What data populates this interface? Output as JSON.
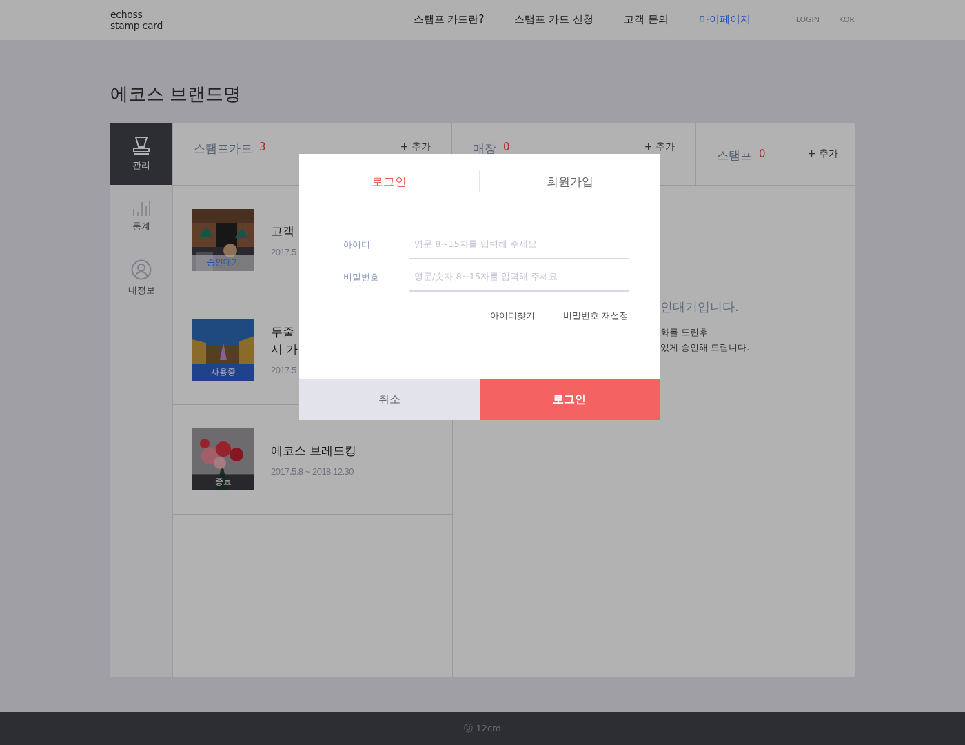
{
  "header": {
    "logo": [
      "echoss",
      "stamp card"
    ],
    "nav": [
      {
        "label": "스탬프 카드란?",
        "selected": false
      },
      {
        "label": "스탬프 카드 신청",
        "selected": false
      },
      {
        "label": "고객 문의",
        "selected": false
      },
      {
        "label": "마이페이지",
        "selected": true
      }
    ],
    "utility": [
      "LOGIN",
      "KOR"
    ]
  },
  "page_title": "에코스 브랜드명",
  "sidebar": {
    "items": [
      {
        "label": "관리",
        "kind": "stamp",
        "selected": true
      },
      {
        "label": "통계",
        "kind": "chart",
        "selected": false
      },
      {
        "label": "내정보",
        "kind": "person",
        "selected": false
      }
    ]
  },
  "columns": [
    {
      "title": "스탬프카드",
      "count": "3",
      "add": "+ 추가"
    },
    {
      "title": "매장",
      "count": "0",
      "add": "+ 추가"
    },
    {
      "title": "스탬프",
      "count": "0",
      "add": "+ 추가"
    }
  ],
  "cards": [
    {
      "title": "고객",
      "date": "2017.5",
      "status": "승인대기",
      "kind": "pending"
    },
    {
      "title": "두줄\n시 가",
      "date": "2017.5",
      "status": "사용중",
      "kind": "active"
    },
    {
      "title": "에코스 브레드킹",
      "date": "2017.5.8 ~ 2018.12.30",
      "status": "종료",
      "kind": "ended"
    }
  ],
  "notice": {
    "heading": "인대기입니다.",
    "lines": [
      "화를 드린후",
      "있게 승인해 드립니다."
    ]
  },
  "footer": "ⓒ 12cm",
  "modal": {
    "tabs": [
      {
        "label": "로그인",
        "selected": true
      },
      {
        "label": "회원가입",
        "selected": false
      }
    ],
    "fields": [
      {
        "label": "아이디",
        "placeholder": "영문 8~15자를 입력해 주세요"
      },
      {
        "label": "비밀번호",
        "placeholder": "영문/숫자 8~15자를 입력해 주세요"
      }
    ],
    "links": [
      "아이디찾기",
      "비밀번호 재설정"
    ],
    "buttons": [
      {
        "label": "취소",
        "kind": "cancel"
      },
      {
        "label": "로그인",
        "kind": "primary"
      }
    ]
  }
}
